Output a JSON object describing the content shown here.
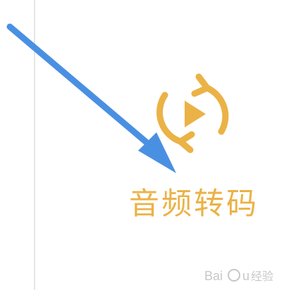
{
  "app": {
    "label": "音频转码",
    "icon": "play-refresh-icon"
  },
  "colors": {
    "accent": "#ebb246",
    "arrow": "#4a90e2",
    "divider": "#e6e6e6",
    "background": "#ffffff"
  },
  "watermark": {
    "text": "Baidu经验"
  }
}
